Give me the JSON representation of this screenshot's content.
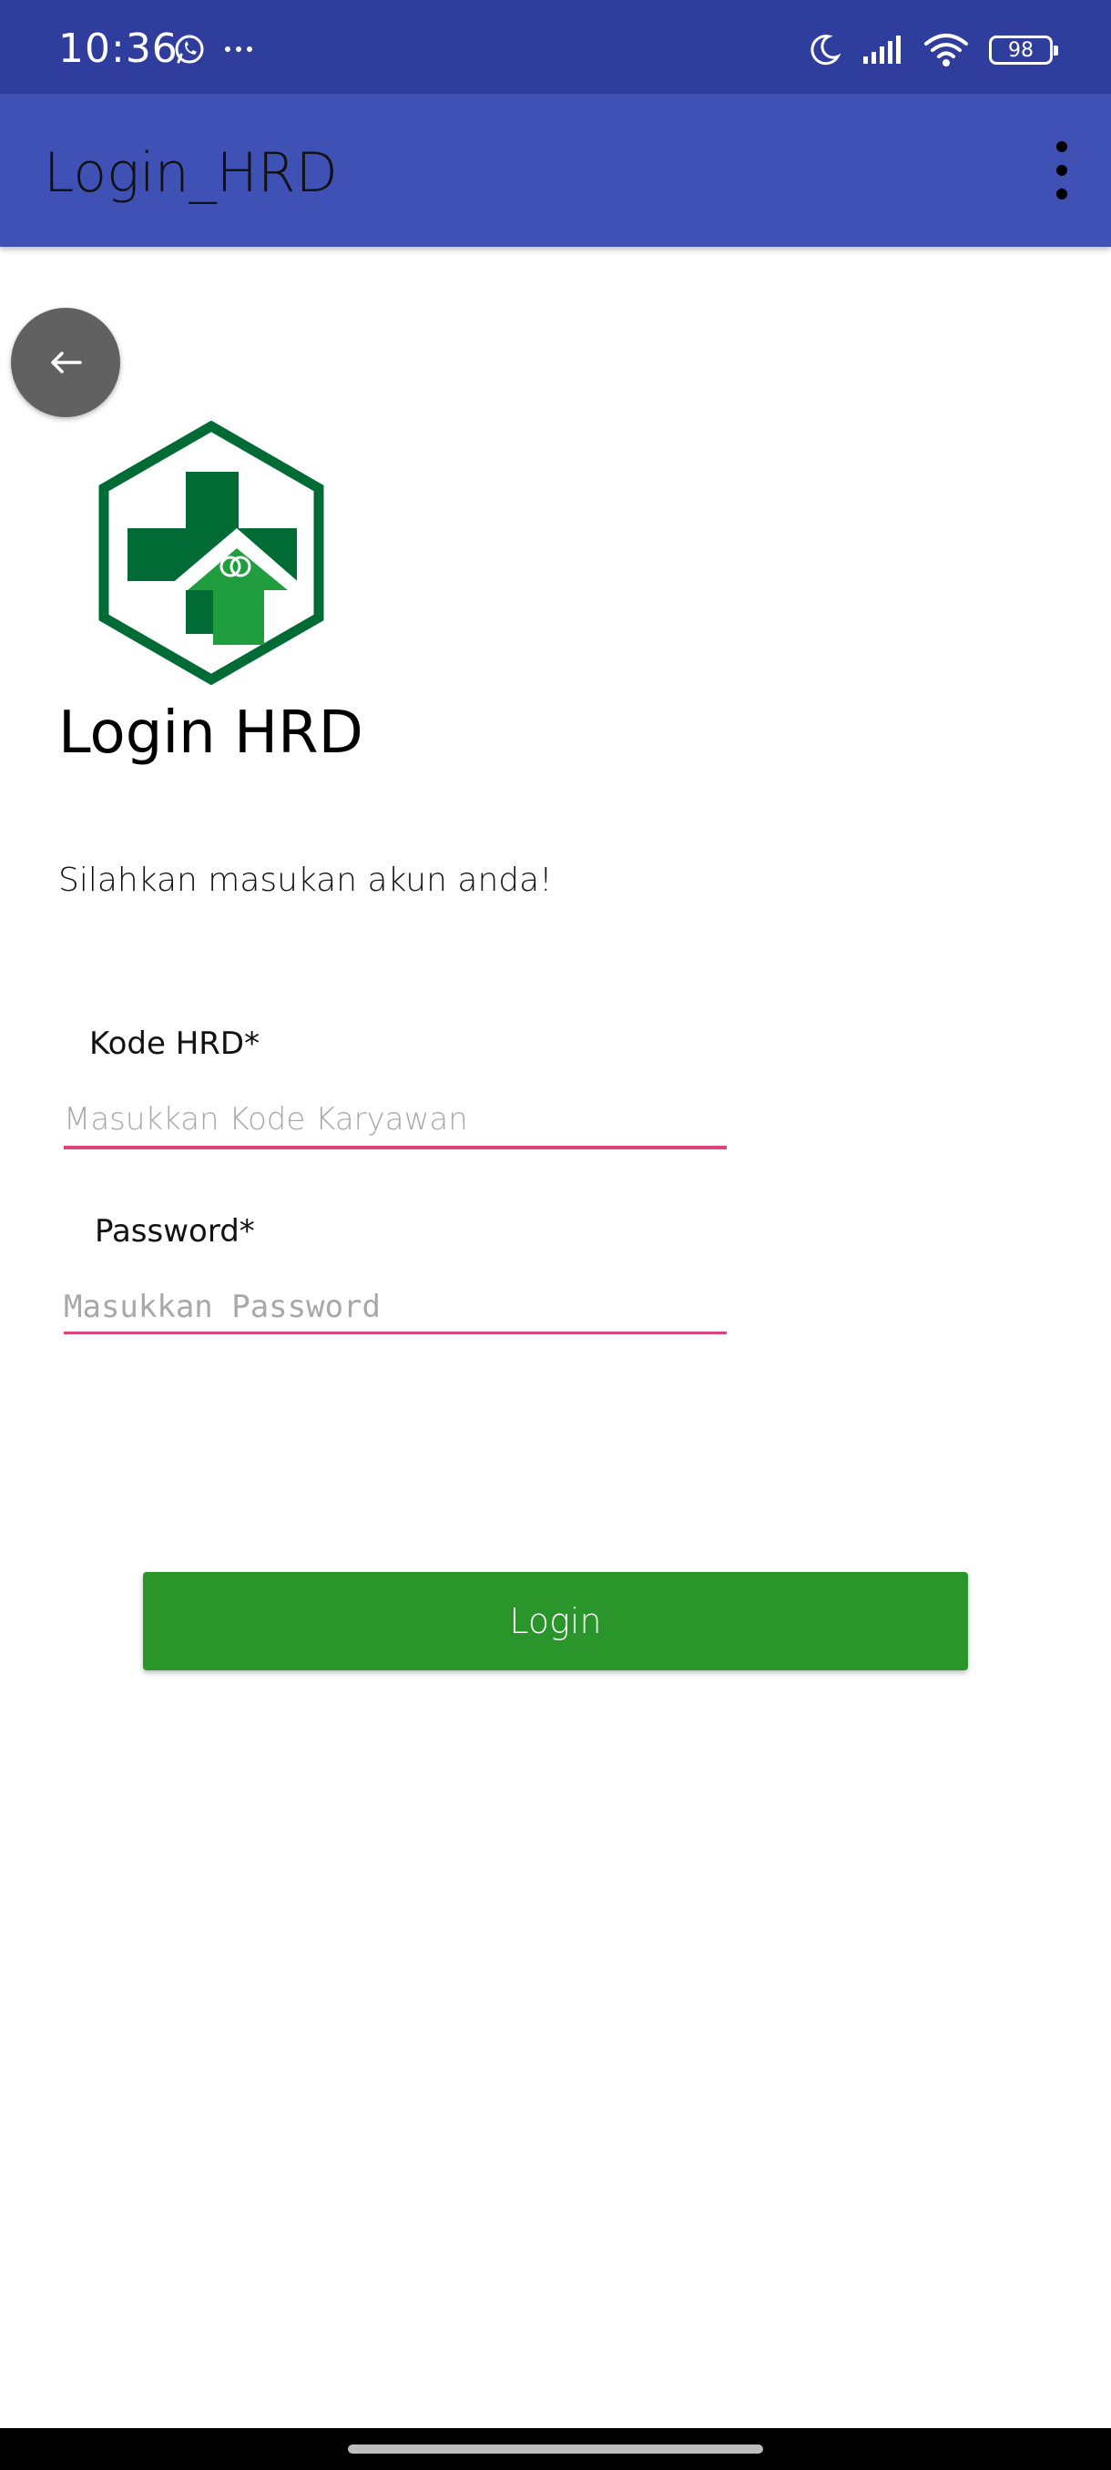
{
  "status_bar": {
    "time": "10:36",
    "battery": "98",
    "icons": [
      "whatsapp-icon",
      "more-dots-icon",
      "moon-icon",
      "signal-icon",
      "wifi-icon",
      "battery-icon"
    ]
  },
  "app_bar": {
    "title": "Login_HRD",
    "menu_icon": "more-vert-icon"
  },
  "back_button": {
    "icon": "arrow-left-icon"
  },
  "logo": {
    "icon": "health-cross-hexagon-logo",
    "colors": {
      "dark_green": "#006b35",
      "light_green": "#1f9d3f"
    }
  },
  "page": {
    "title": "Login HRD",
    "subtitle": "Silahkan masukan akun anda!"
  },
  "form": {
    "kode": {
      "label": "Kode HRD*",
      "value": "",
      "placeholder": "Masukkan Kode Karyawan"
    },
    "password": {
      "label": "Password*",
      "value": "",
      "placeholder": "Masukkan Password"
    },
    "login_label": "Login"
  },
  "colors": {
    "status_bar": "#2f3d9c",
    "app_bar": "#3f51b5",
    "accent_underline": "#e0437b",
    "login_button": "#2a952b",
    "back_button": "#616161"
  }
}
